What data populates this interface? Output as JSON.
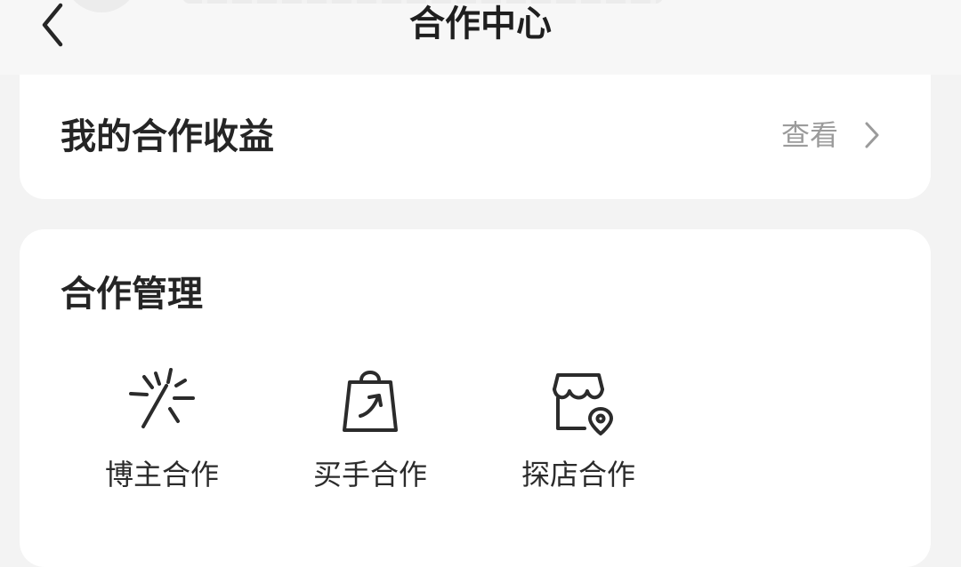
{
  "header": {
    "title": "合作中心"
  },
  "earnings": {
    "title": "我的合作收益",
    "link_label": "查看"
  },
  "management": {
    "title": "合作管理",
    "items": [
      {
        "label": "博主合作",
        "icon": "sparkle-burst-icon"
      },
      {
        "label": "买手合作",
        "icon": "shopping-bag-icon"
      },
      {
        "label": "探店合作",
        "icon": "store-location-icon"
      }
    ]
  }
}
